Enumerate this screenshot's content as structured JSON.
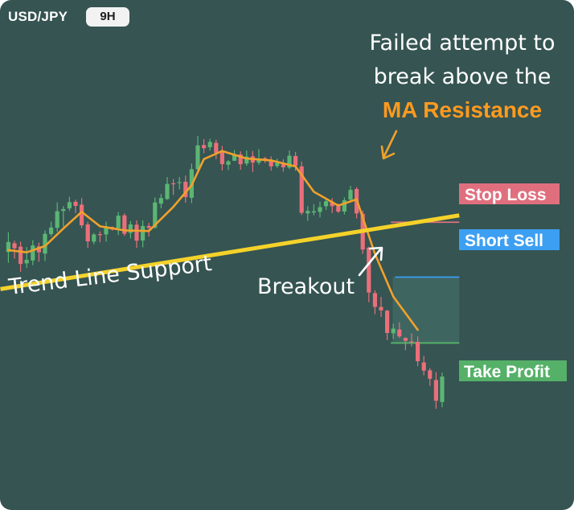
{
  "header": {
    "symbol": "USD/JPY",
    "timeframe": "9H"
  },
  "colors": {
    "background": "#355452",
    "bull": "#5bb673",
    "bear": "#ea6f7a",
    "moving_average": "#f0a12c",
    "trend_line": "#f5d22a",
    "stop_loss": "#e06f7e",
    "short_sell": "#3d9ff2",
    "take_profit": "#55b068",
    "highlight": "#ff9a1f"
  },
  "annotations": {
    "failed_line1": "Failed attempt to",
    "failed_line2": "break above the",
    "failed_highlight": "MA Resistance",
    "trend_line": "Trend Line Support",
    "breakout": "Breakout"
  },
  "trade": {
    "stop_loss_label": "Stop Loss",
    "short_sell_label": "Short Sell",
    "take_profit_label": "Take Profit",
    "stop_loss": 272.5,
    "short_sell": 255,
    "take_profit": 234
  },
  "chart_data": {
    "type": "candlestick",
    "symbol": "USD/JPY",
    "timeframe": "9H",
    "ylim": [
      210,
      310
    ],
    "grid": false,
    "candles": [
      [
        1,
        263,
        266.2,
        259.6,
        269.3
      ],
      [
        2,
        265.8,
        264.2,
        260.9,
        266.6
      ],
      [
        3,
        264.7,
        259.2,
        256.7,
        266.3
      ],
      [
        4,
        259.4,
        260.5,
        257.9,
        264.6
      ],
      [
        5,
        260.3,
        265.1,
        258.8,
        266.8
      ],
      [
        6,
        264.8,
        262.9,
        259.9,
        266
      ],
      [
        7,
        262.5,
        268.8,
        260.1,
        269.9
      ],
      [
        8,
        268.7,
        270.8,
        268,
        272.7
      ],
      [
        9,
        270.7,
        276,
        269.5,
        278.8
      ],
      [
        10,
        276.1,
        276.7,
        271.1,
        277.6
      ],
      [
        11,
        276.9,
        278.9,
        276.1,
        280.6
      ],
      [
        12,
        279,
        277.7,
        275.4,
        279.7
      ],
      [
        13,
        278.1,
        271.5,
        270.6,
        280.2
      ],
      [
        14,
        271.8,
        266.4,
        264.3,
        272.7
      ],
      [
        15,
        266.3,
        268.6,
        265.4,
        269.1
      ],
      [
        16,
        268.7,
        268.5,
        266.1,
        269.6
      ],
      [
        17,
        268.6,
        271.2,
        266.3,
        272.7
      ],
      [
        18,
        271,
        270.2,
        269.8,
        271.1
      ],
      [
        19,
        270.6,
        274.6,
        268.4,
        275.8
      ],
      [
        20,
        274.7,
        268.8,
        268.1,
        275.3
      ],
      [
        21,
        269.1,
        271.8,
        267.3,
        272.9
      ],
      [
        22,
        271.7,
        266.6,
        264.3,
        273.1
      ],
      [
        23,
        266.7,
        271.3,
        264.5,
        273.1
      ],
      [
        24,
        271.3,
        270.7,
        267.9,
        272.3
      ],
      [
        25,
        270.8,
        278.8,
        270.4,
        280.4
      ],
      [
        26,
        278.4,
        280.2,
        276.9,
        281.5
      ],
      [
        27,
        279.9,
        284.7,
        279.6,
        286.9
      ],
      [
        28,
        284.9,
        284.8,
        281.2,
        286.3
      ],
      [
        29,
        285,
        285.3,
        283,
        286.9
      ],
      [
        30,
        285.4,
        280.5,
        278.7,
        287.4
      ],
      [
        31,
        280.3,
        289.4,
        278.6,
        291.2
      ],
      [
        32,
        289.4,
        297,
        288.8,
        300
      ],
      [
        33,
        297.1,
        296.1,
        294.5,
        299
      ],
      [
        34,
        296.4,
        298.1,
        295.3,
        299.1
      ],
      [
        35,
        297.8,
        294.6,
        292.6,
        298.8
      ],
      [
        36,
        294.9,
        291,
        289,
        296.8
      ],
      [
        37,
        290.8,
        291.9,
        289.1,
        292.3
      ],
      [
        38,
        292.1,
        294.1,
        292,
        295.5
      ],
      [
        39,
        294.1,
        291,
        289.2,
        295.1
      ],
      [
        40,
        291.2,
        293.4,
        290.5,
        295.4
      ],
      [
        41,
        293.5,
        291.5,
        288.5,
        295.2
      ],
      [
        42,
        291.5,
        292.8,
        290.8,
        295.8
      ],
      [
        43,
        292.9,
        292.2,
        291.4,
        293.3
      ],
      [
        44,
        292.4,
        290.3,
        288.9,
        293.5
      ],
      [
        45,
        290.4,
        291.4,
        289.8,
        292.8
      ],
      [
        46,
        291,
        290,
        288.6,
        292.6
      ],
      [
        47,
        289.9,
        293.7,
        289.4,
        295.4
      ],
      [
        48,
        293.6,
        290.5,
        288.9,
        294.9
      ],
      [
        49,
        290.3,
        275.5,
        274.8,
        291.9
      ],
      [
        50,
        275.3,
        276.1,
        272.9,
        277.6
      ],
      [
        51,
        275.6,
        276,
        274.7,
        278.3
      ],
      [
        52,
        275.8,
        277.3,
        274,
        279
      ],
      [
        53,
        277.6,
        279.2,
        276.4,
        279.8
      ],
      [
        54,
        279,
        277.6,
        275.4,
        280.2
      ],
      [
        55,
        277.6,
        275.9,
        275.4,
        278.4
      ],
      [
        56,
        275.9,
        279.5,
        275,
        280.4
      ],
      [
        57,
        279.7,
        282.8,
        278.8,
        284.1
      ],
      [
        58,
        283.1,
        275.3,
        273.7,
        283.7
      ],
      [
        59,
        275.2,
        263.8,
        262.4,
        276.2
      ],
      [
        60,
        264.4,
        250.1,
        247,
        264.7
      ],
      [
        61,
        249.9,
        245.5,
        243.2,
        250.8
      ],
      [
        62,
        245.5,
        244.4,
        242.3,
        248.7
      ],
      [
        63,
        244.3,
        237.2,
        234.9,
        244.6
      ],
      [
        64,
        237.1,
        238.6,
        235.3,
        240.2
      ],
      [
        65,
        238.3,
        236.1,
        235.6,
        240.6
      ],
      [
        66,
        235.6,
        234.7,
        231.7,
        235.8
      ],
      [
        67,
        234.5,
        234.3,
        232.9,
        237.1
      ],
      [
        68,
        234.4,
        228.2,
        226.6,
        236.1
      ],
      [
        69,
        227.8,
        225.2,
        223.7,
        229.9
      ],
      [
        70,
        225.3,
        222.6,
        220.3,
        226
      ],
      [
        71,
        222.2,
        215.6,
        213,
        224.7
      ],
      [
        72,
        215.2,
        223.3,
        213.5,
        224.6
      ]
    ],
    "moving_average": [
      [
        1,
        263.6
      ],
      [
        4,
        262.9
      ],
      [
        7,
        264.9
      ],
      [
        10,
        270.5
      ],
      [
        13,
        275.8
      ],
      [
        16,
        271.2
      ],
      [
        20,
        269.9
      ],
      [
        24,
        269.7
      ],
      [
        28,
        277.4
      ],
      [
        31,
        284.3
      ],
      [
        33,
        292.6
      ],
      [
        36,
        295.2
      ],
      [
        40,
        292.8
      ],
      [
        44,
        292.2
      ],
      [
        48,
        290.3
      ],
      [
        51,
        282.2
      ],
      [
        55,
        277.8
      ],
      [
        58,
        279.8
      ],
      [
        61,
        262.4
      ],
      [
        64,
        248.8
      ],
      [
        68,
        238.2
      ]
    ],
    "trend_line": [
      [
        1,
        251.6
      ],
      [
        72,
        273.8
      ]
    ],
    "levels": [
      {
        "label": "Stop Loss",
        "value": 272.5
      },
      {
        "label": "Short Sell",
        "value": 255
      },
      {
        "label": "Take Profit",
        "value": 234
      }
    ]
  }
}
